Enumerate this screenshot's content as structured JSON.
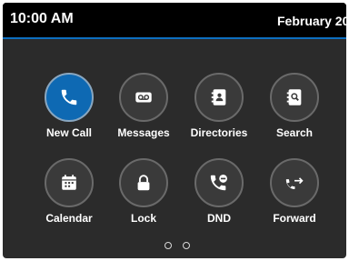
{
  "status_bar": {
    "time": "10:00 AM",
    "date": "February 20"
  },
  "colors": {
    "accent": "#0d6fc0",
    "active_tile": "#0e69b3",
    "background": "#2b2b2b"
  },
  "tiles": [
    {
      "label": "New Call",
      "icon": "phone-handset-icon",
      "active": true
    },
    {
      "label": "Messages",
      "icon": "voicemail-icon"
    },
    {
      "label": "Directories",
      "icon": "contact-directory-icon"
    },
    {
      "label": "Search",
      "icon": "search-directory-icon"
    },
    {
      "label": "Calendar",
      "icon": "calendar-icon"
    },
    {
      "label": "Lock",
      "icon": "lock-icon"
    },
    {
      "label": "DND",
      "icon": "do-not-disturb-icon"
    },
    {
      "label": "Forward",
      "icon": "call-forward-icon"
    }
  ],
  "pagination": {
    "pages": 2,
    "current": 1
  }
}
